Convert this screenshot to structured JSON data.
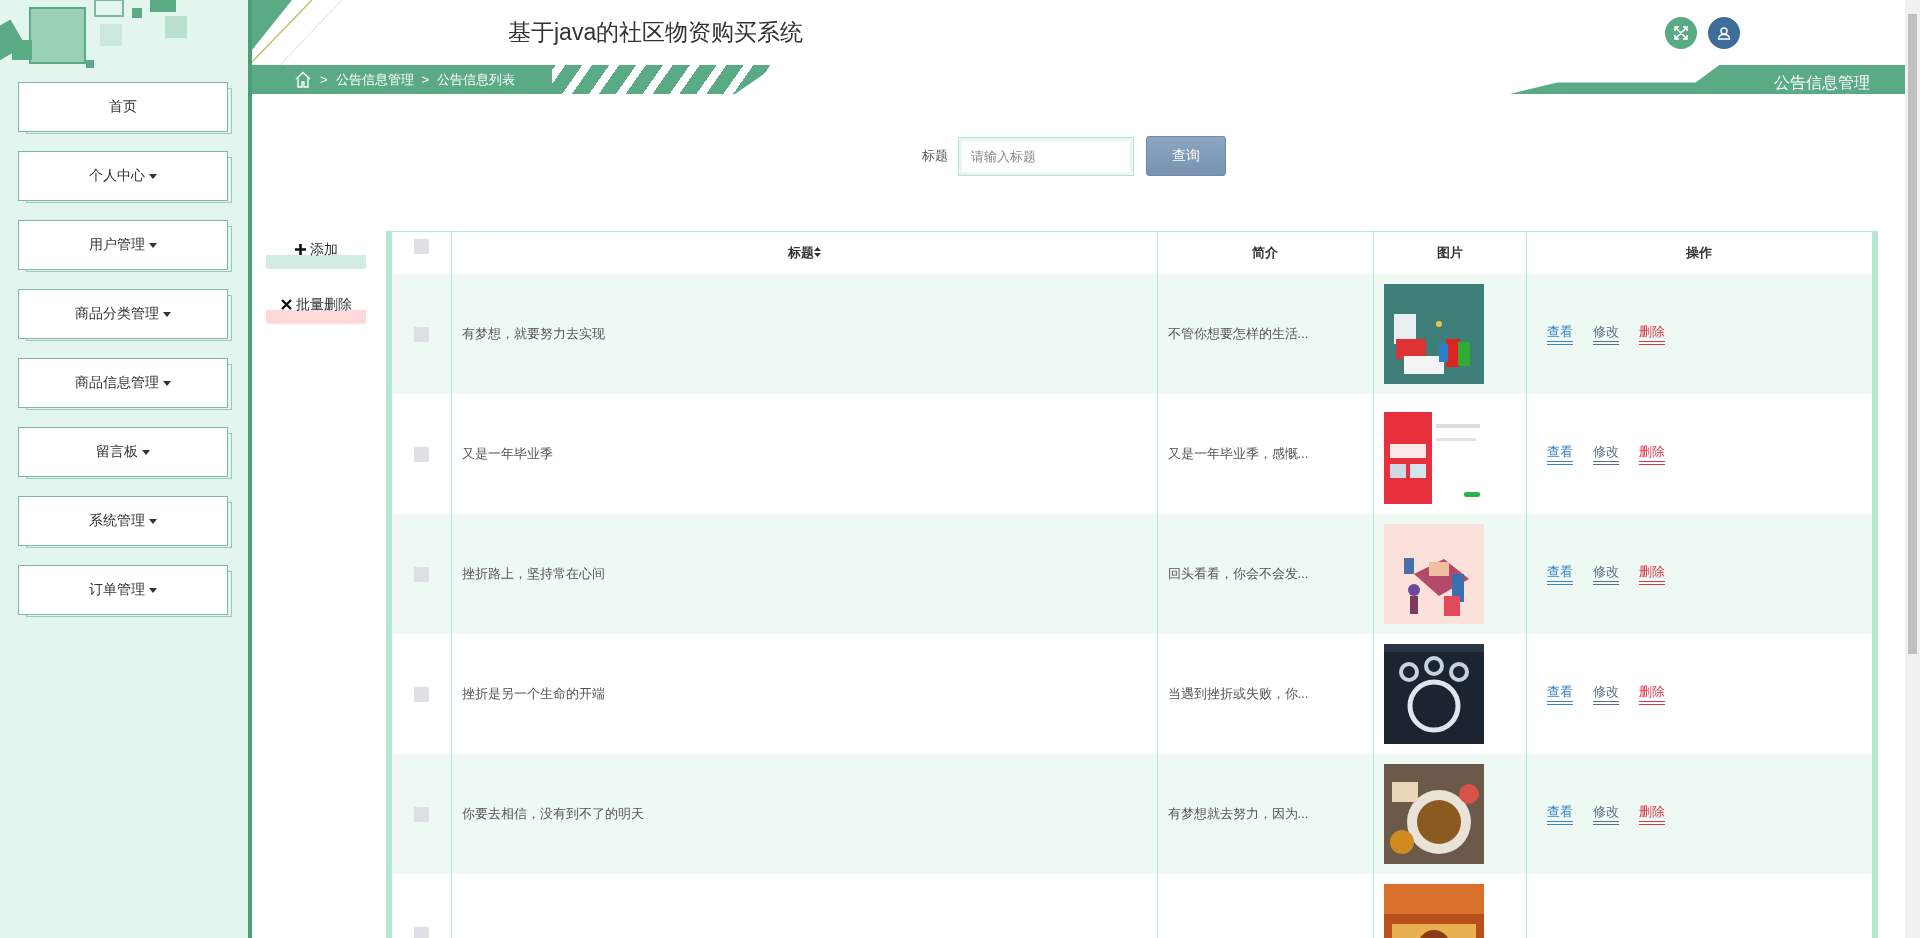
{
  "header": {
    "title": "基于java的社区物资购买系统",
    "section": "公告信息管理"
  },
  "breadcrumb": [
    {
      "separator": ">",
      "label": "公告信息管理"
    },
    {
      "separator": ">",
      "label": "公告信息列表"
    }
  ],
  "sidebar": {
    "items": [
      {
        "label": "首页",
        "dropdown": false
      },
      {
        "label": "个人中心",
        "dropdown": true
      },
      {
        "label": "用户管理",
        "dropdown": true
      },
      {
        "label": "商品分类管理",
        "dropdown": true
      },
      {
        "label": "商品信息管理",
        "dropdown": true
      },
      {
        "label": "留言板",
        "dropdown": true
      },
      {
        "label": "系统管理",
        "dropdown": true
      },
      {
        "label": "订单管理",
        "dropdown": true
      }
    ]
  },
  "search": {
    "label": "标题",
    "placeholder": "请输入标题",
    "button": "查询"
  },
  "actions": [
    {
      "kind": "add",
      "label": "添加"
    },
    {
      "kind": "delete",
      "label": "批量删除"
    }
  ],
  "table": {
    "header_checked": false,
    "columns": [
      {
        "label": "标题",
        "sortable": true
      },
      {
        "label": "简介",
        "sortable": false
      },
      {
        "label": "图片",
        "sortable": false
      },
      {
        "label": "操作",
        "sortable": false
      }
    ],
    "rows": [
      {
        "checked": false,
        "title": "有梦想，就要努力去实现",
        "intro": "不管你想要怎样的生活...",
        "picture": {
          "kind": "picture"
        },
        "actions": [
          {
            "kind": "view",
            "label": "查看"
          },
          {
            "kind": "edit",
            "label": "修改"
          },
          {
            "kind": "delete",
            "label": "删除"
          }
        ]
      },
      {
        "checked": false,
        "title": "又是一年毕业季",
        "intro": "又是一年毕业季，感慨...",
        "picture": {
          "kind": "picture"
        },
        "actions": [
          {
            "kind": "view",
            "label": "查看"
          },
          {
            "kind": "edit",
            "label": "修改"
          },
          {
            "kind": "delete",
            "label": "删除"
          }
        ]
      },
      {
        "checked": false,
        "title": "挫折路上，坚持常在心间",
        "intro": "回头看看，你会不会发...",
        "picture": {
          "kind": "picture"
        },
        "actions": [
          {
            "kind": "view",
            "label": "查看"
          },
          {
            "kind": "edit",
            "label": "修改"
          },
          {
            "kind": "delete",
            "label": "删除"
          }
        ]
      },
      {
        "checked": false,
        "title": "挫折是另一个生命的开端",
        "intro": "当遇到挫折或失败，你...",
        "picture": {
          "kind": "picture"
        },
        "actions": [
          {
            "kind": "view",
            "label": "查看"
          },
          {
            "kind": "edit",
            "label": "修改"
          },
          {
            "kind": "delete",
            "label": "删除"
          }
        ]
      },
      {
        "checked": false,
        "title": "你要去相信，没有到不了的明天",
        "intro": "有梦想就去努力，因为...",
        "picture": {
          "kind": "picture"
        },
        "actions": [
          {
            "kind": "view",
            "label": "查看"
          },
          {
            "kind": "edit",
            "label": "修改"
          },
          {
            "kind": "delete",
            "label": "删除"
          }
        ]
      },
      {
        "checked": false,
        "picture": {
          "kind": "picture"
        }
      }
    ]
  }
}
